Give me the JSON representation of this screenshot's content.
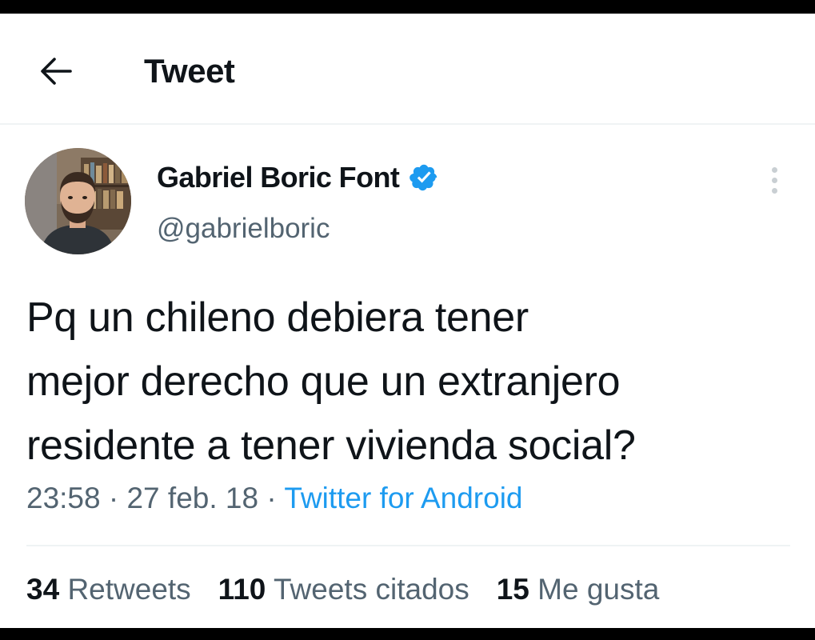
{
  "header": {
    "title": "Tweet",
    "back_icon": "arrow-left-icon"
  },
  "author": {
    "name": "Gabriel Boric Font",
    "handle": "@gabrielboric",
    "verified_icon": "verified-badge-icon",
    "verified_color": "#1d9bf0"
  },
  "tweet": {
    "lines": [
      "Pq un chileno debiera tener",
      "mejor derecho que un extranjero",
      "residente a tener vivienda social?"
    ],
    "time": "23:58",
    "separator": "·",
    "date": "27 feb. 18",
    "source": "Twitter for Android"
  },
  "stats": {
    "retweets_count": "34",
    "retweets_label": "Retweets",
    "quotes_count": "110",
    "quotes_label": "Tweets citados",
    "likes_count": "15",
    "likes_label": "Me gusta"
  },
  "colors": {
    "text_primary": "#0f1419",
    "text_secondary": "#536471",
    "accent": "#1d9bf0",
    "divider": "#eff3f4"
  }
}
